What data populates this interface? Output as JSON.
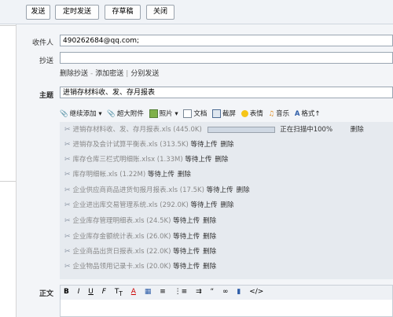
{
  "toolbar": {
    "send": "发送",
    "scheduled_send": "定时发送",
    "save_draft": "存草稿",
    "close": "关闭"
  },
  "recipients": {
    "to_label": "收件人",
    "to_value": "490262684@qq.com;",
    "cc_label": "抄送",
    "cc_value": "",
    "remove_cc": "删除抄送",
    "add_bcc": "添加密送",
    "separate_send": "分别发送"
  },
  "subject": {
    "label": "主题",
    "value": "进销存材料收、发、存月报表"
  },
  "attach_toolbar": {
    "continue_add": "继续添加",
    "large_attachment": "超大附件",
    "photo": "照片",
    "document": "文档",
    "screenshot": "截屏",
    "emoji": "表情",
    "music": "音乐",
    "format": "格式"
  },
  "attachments": [
    {
      "name": "进销存材料收、发、存月报表.xls (445.0K)",
      "status": "正在扫描中100%",
      "action": "删除",
      "progress": 1.0
    },
    {
      "name": "进销存及会计试算平衡表.xls (313.5K)",
      "status": "等待上传",
      "action": "删除"
    },
    {
      "name": "库存仓库三栏式明细账.xlsx (1.33M)",
      "status": "等待上传",
      "action": "删除"
    },
    {
      "name": "库存明细帐.xls (1.22M)",
      "status": "等待上传",
      "action": "删除"
    },
    {
      "name": "企业供应商商品进货旬报月报表.xls (17.5K)",
      "status": "等待上传",
      "action": "删除"
    },
    {
      "name": "企业进出库交易管理系统.xls (292.0K)",
      "status": "等待上传",
      "action": "删除"
    },
    {
      "name": "企业库存管理明细表.xls (24.5K)",
      "status": "等待上传",
      "action": "删除"
    },
    {
      "name": "企业库存金额统计表.xls (26.0K)",
      "status": "等待上传",
      "action": "删除"
    },
    {
      "name": "企业商品出货日报表.xls (22.0K)",
      "status": "等待上传",
      "action": "删除"
    },
    {
      "name": "企业物品领用记录卡.xls (20.0K)",
      "status": "等待上传",
      "action": "删除"
    }
  ],
  "body": {
    "label": "正文"
  },
  "editor": {
    "bold": "B",
    "italic": "I",
    "underline": "U",
    "html": "</>"
  }
}
